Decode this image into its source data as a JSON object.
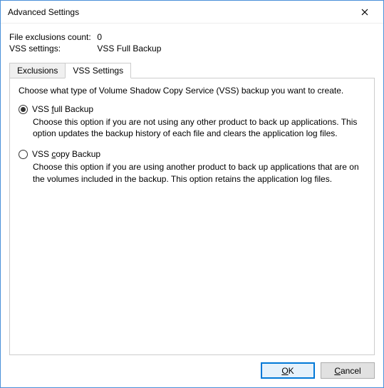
{
  "title": "Advanced Settings",
  "info": {
    "exclusions_label": "File exclusions count:",
    "exclusions_value": "0",
    "vss_label": "VSS settings:",
    "vss_value": "VSS Full Backup"
  },
  "tabs": {
    "exclusions": "Exclusions",
    "vss": "VSS Settings"
  },
  "panel": {
    "description": "Choose what type of Volume Shadow Copy Service (VSS) backup you want to create.",
    "option1": {
      "prefix": "VSS ",
      "hotkey": "f",
      "suffix": "ull Backup",
      "desc": "Choose this option if you are not using any other product to back up applications. This option updates the backup history of each file and clears the application log files."
    },
    "option2": {
      "prefix": "VSS ",
      "hotkey": "c",
      "suffix": "opy Backup",
      "desc": "Choose this option if you are using another product to back up applications that are on the volumes included in the backup. This option retains the application log files."
    }
  },
  "buttons": {
    "ok_u": "O",
    "ok_rest": "K",
    "cancel_pre": "",
    "cancel_u": "C",
    "cancel_rest": "ancel"
  }
}
